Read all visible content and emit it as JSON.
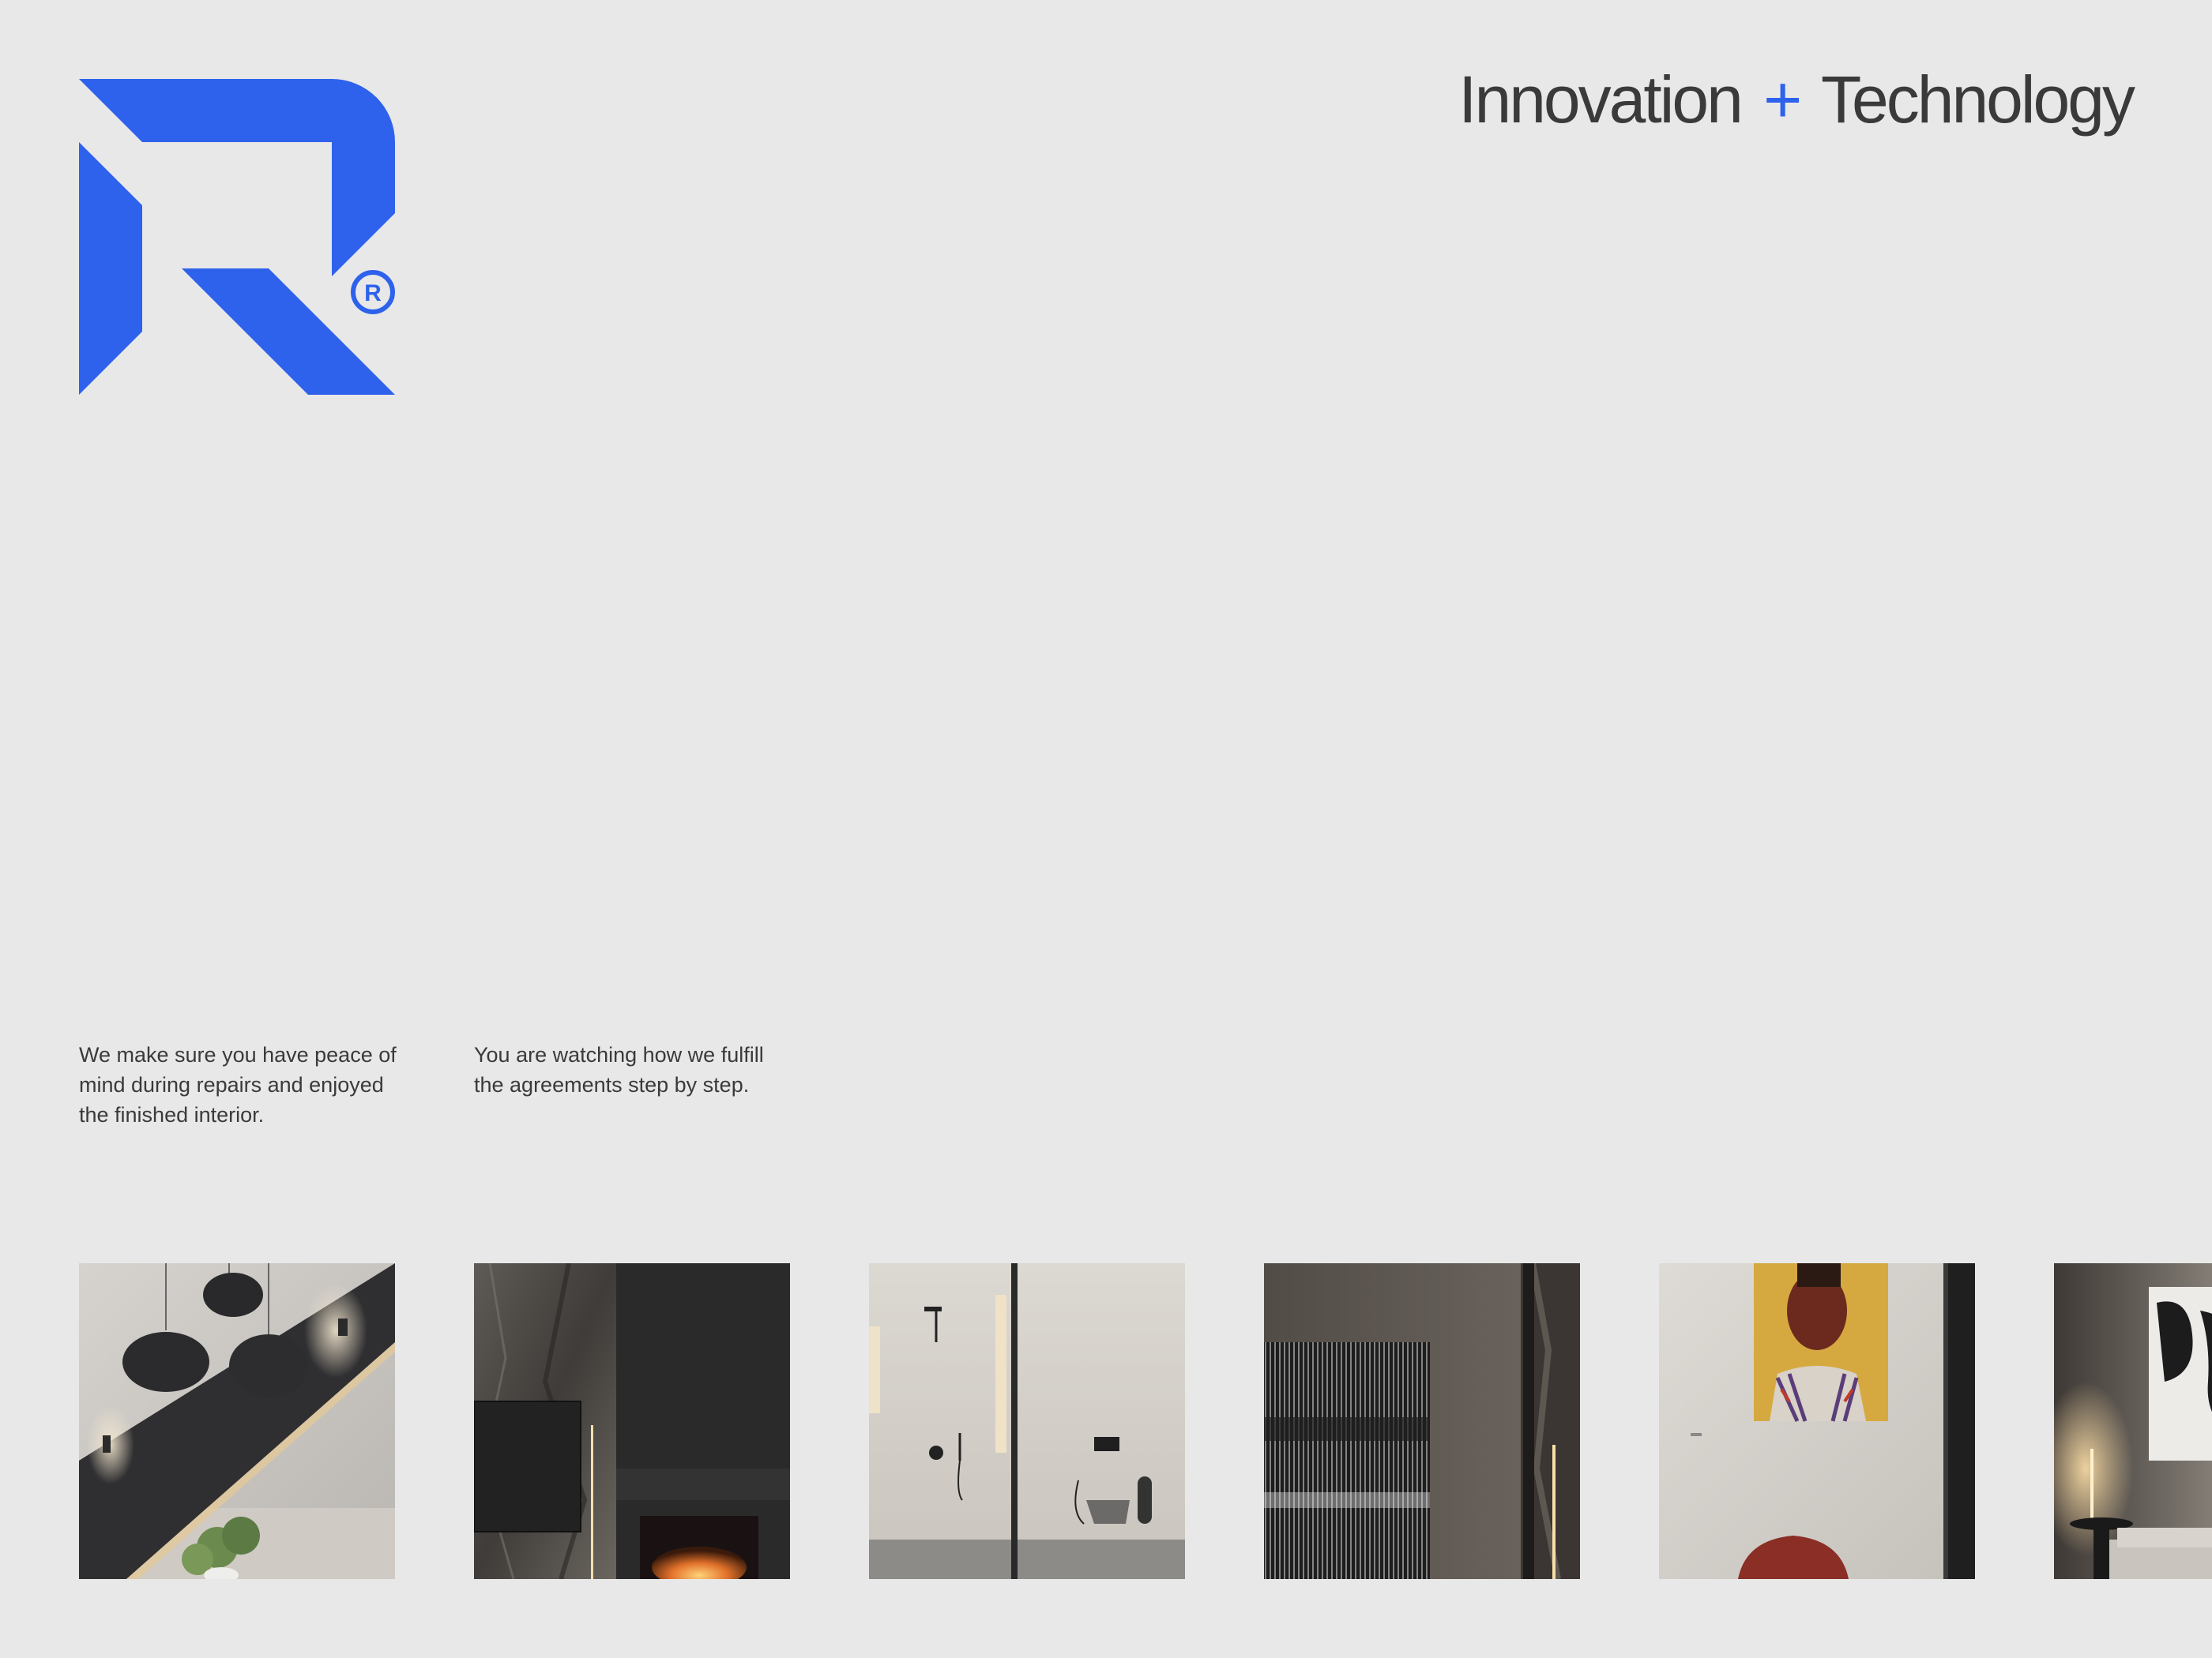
{
  "brand": {
    "logo_icon": "r-registered-logo-icon",
    "accent_color": "#2e62ec"
  },
  "tagline": {
    "word_1": "Innovation",
    "plus": "+",
    "word_2": "Technology"
  },
  "descriptions": [
    "We make sure you have peace of mind during repairs and enjoyed the finished interior.",
    "You are watching how we fulfill the agreements step by step."
  ],
  "gallery": {
    "images": [
      {
        "name": "interior-pendant-lamps-staircase"
      },
      {
        "name": "interior-fireplace-stone-wall"
      },
      {
        "name": "interior-shower-bathroom"
      },
      {
        "name": "interior-abstract-art-wall"
      },
      {
        "name": "interior-portrait-painting-chair"
      },
      {
        "name": "interior-abstract-painting-sofa"
      }
    ]
  }
}
